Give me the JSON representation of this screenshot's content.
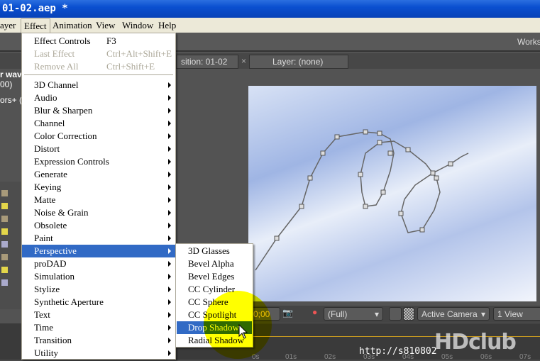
{
  "title": "01-02.aep *",
  "menubar": [
    "ayer",
    "Effect",
    "Animation",
    "View",
    "Window",
    "Help"
  ],
  "effect_menu": {
    "top": [
      {
        "label": "Effect Controls",
        "shortcut": "F3",
        "disabled": false
      },
      {
        "label": "Last Effect",
        "shortcut": "Ctrl+Alt+Shift+E",
        "disabled": true
      },
      {
        "label": "Remove All",
        "shortcut": "Ctrl+Shift+E",
        "disabled": true
      }
    ],
    "categories": [
      "3D Channel",
      "Audio",
      "Blur & Sharpen",
      "Channel",
      "Color Correction",
      "Distort",
      "Expression Controls",
      "Generate",
      "Keying",
      "Matte",
      "Noise & Grain",
      "Obsolete",
      "Paint",
      "Perspective",
      "proDAD",
      "Simulation",
      "Stylize",
      "Synthetic Aperture",
      "Text",
      "Time",
      "Transition",
      "Utility"
    ],
    "highlighted": "Perspective"
  },
  "perspective_submenu": {
    "items": [
      "3D Glasses",
      "Bevel Alpha",
      "Bevel Edges",
      "CC Cylinder",
      "CC Sphere",
      "CC Spotlight",
      "Drop Shadow",
      "Radial Shadow"
    ],
    "highlighted": "Drop Shadow"
  },
  "panels": {
    "workspace": "Works",
    "comp_tab": "sition: 01-02",
    "layer_tab": "Layer: (none)",
    "left_text": [
      "r wav",
      "00)",
      "ors+ ("
    ]
  },
  "viewer_controls": {
    "timecode": "0;00",
    "resolution": "(Full)",
    "camera": "Active Camera",
    "views": "1 View"
  },
  "timeline": {
    "ticks": [
      "0s",
      "01s",
      "02s",
      "03s",
      "04s",
      "05s",
      "06s",
      "07s"
    ]
  },
  "watermark": {
    "url": "http://s810802",
    "logo": "HDclub"
  },
  "colors": {
    "menu_highlight": "#316ac5",
    "spotlight": "#ffff00"
  }
}
